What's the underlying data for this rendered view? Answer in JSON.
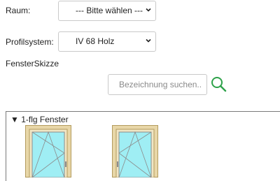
{
  "form": {
    "room_label": "Raum:",
    "room_select_value": "--- Bitte wählen ---",
    "profile_label": "Profilsystem:",
    "profile_select_value": "IV 68 Holz",
    "sketch_heading": "FensterSkizze"
  },
  "search": {
    "placeholder": "Bezeichnung suchen..",
    "icon": "search-icon"
  },
  "sketch_panel": {
    "section_label": "▼ 1-flg Fenster",
    "items": [
      {
        "icon": "window-tilt-turn-left-icon"
      },
      {
        "icon": "window-tilt-turn-right-icon"
      }
    ]
  },
  "colors": {
    "frame_wood": "#e8d7a8",
    "frame_outline": "#b39b5e",
    "glass": "#9feef4",
    "search_icon": "#2ea24a"
  }
}
